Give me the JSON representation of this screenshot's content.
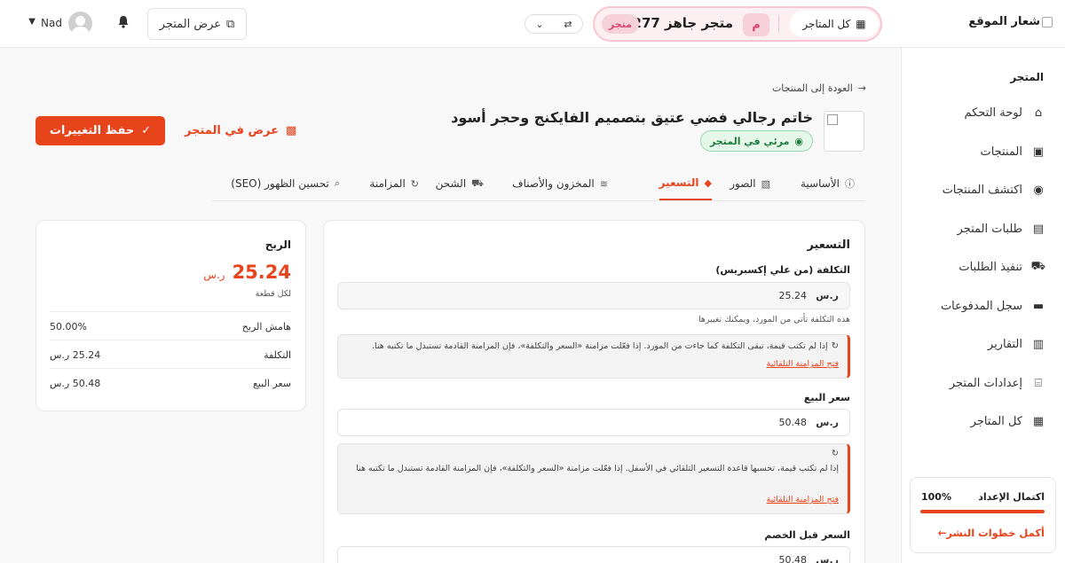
{
  "header": {
    "logo_text": "شعار الموقع",
    "all_stores_label": "كل المتاجر",
    "store_initial": "م",
    "store_name": "متجر جاهز 277",
    "store_badge": "متجر",
    "view_store_label": "عرض المتجر",
    "username": "Nad"
  },
  "sidebar": {
    "section_title": "المتجر",
    "items": [
      {
        "label": "لوحة التحكم",
        "icon": "home-icon"
      },
      {
        "label": "المنتجات",
        "icon": "box-icon"
      },
      {
        "label": "اكتشف المنتجات",
        "icon": "compass-icon"
      },
      {
        "label": "طلبات المتجر",
        "icon": "receipt-icon"
      },
      {
        "label": "تنفيذ الطلبات",
        "icon": "truck-icon"
      },
      {
        "label": "سجل المدفوعات",
        "icon": "money-icon"
      },
      {
        "label": "التقارير",
        "icon": "chart-icon"
      },
      {
        "label": "إعدادات المتجر",
        "icon": "store-icon"
      },
      {
        "label": "كل المتاجر",
        "icon": "grid-icon"
      }
    ],
    "setup": {
      "title": "اكتمال الإعداد",
      "percent_label": "100%",
      "progress": 1.0,
      "link": "أكمل خطوات النشر←"
    }
  },
  "product": {
    "back_label": "العودة إلى المنتجات",
    "title": "خاتم رجالي فضي عتيق بتصميم الفايكنج وحجر أسود",
    "visibility_badge": "مرئي في المتجر",
    "view_in_store": "عرض في المتجر",
    "save_label": "حفظ التغييرات"
  },
  "tabs": [
    {
      "label": "الأساسية",
      "icon": "info-icon",
      "active": false
    },
    {
      "label": "الصور",
      "icon": "images-icon",
      "active": false
    },
    {
      "label": "التسعير",
      "icon": "tag-icon",
      "active": true
    },
    {
      "label": "المخزون والأصناف",
      "icon": "layers-icon",
      "active": false
    },
    {
      "label": "الشحن",
      "icon": "truck-icon",
      "active": false
    },
    {
      "label": "المزامنة",
      "icon": "sync-icon",
      "active": false
    },
    {
      "label": "تحسين الظهور (SEO)",
      "icon": "search-icon",
      "active": false
    }
  ],
  "pricing": {
    "title": "التسعير",
    "cost_label": "التكلفة (من علي إكسبريس)",
    "cost_currency": "ر.س",
    "cost_value": "25.24",
    "cost_help": "هذه التكلفة تأتي من المورد، ويمكنك تغييرها",
    "cost_notice": "إذا لم تكتب قيمة، تبقى التكلفة كما جاءت من المورد. إذا فعّلت مزامنة «السعر والتكلفة»، فإن المزامنة القادمة تستبدل ما تكتبه هنا.",
    "cost_notice_link": "فتح المزامنة التلقائية",
    "sale_label": "سعر البيع",
    "sale_currency": "ر.س",
    "sale_value": "50.48",
    "sale_notice": "إذا لم تكتب قيمة، تحسبها قاعدة التسعير التلقائي في الأسفل. إذا فعّلت مزامنة «السعر والتكلفة»، فإن المزامنة القادمة تستبدل ما تكتبه هنا",
    "sale_notice_link": "فتح المزامنة التلقائية",
    "compare_label": "السعر قبل الخصم",
    "compare_currency": "ر.س",
    "compare_value": "50.48"
  },
  "profit": {
    "title": "الربح",
    "amount": "25.24",
    "currency": "ر.س",
    "per_unit": "لكل قطعة",
    "rows": [
      {
        "label": "هامش الربح",
        "value": "50.00%"
      },
      {
        "label": "التكلفة",
        "value": "25.24 ر.س"
      },
      {
        "label": "سعر البيع",
        "value": "50.48 ر.س"
      }
    ]
  },
  "colors": {
    "accent": "#e8441c",
    "success": "#1e7d3d",
    "store_pill": "#f7c6cf"
  }
}
